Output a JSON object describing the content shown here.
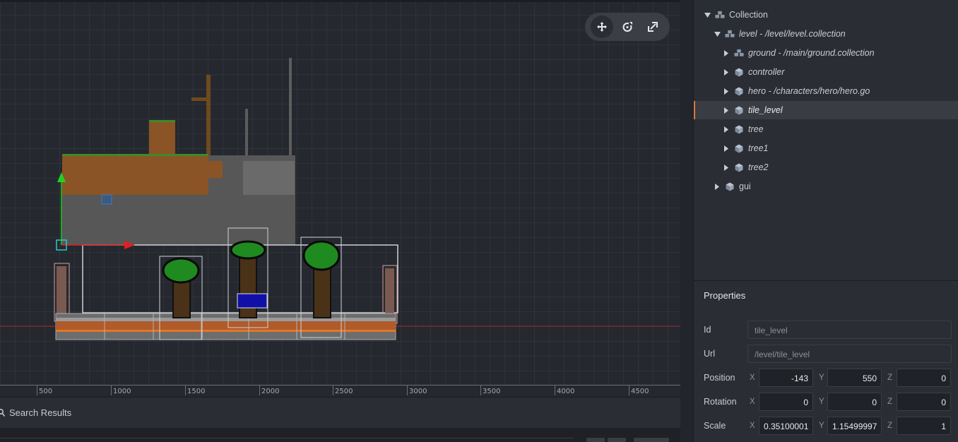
{
  "viewport": {
    "ruler": [
      "500",
      "1000",
      "1500",
      "2000",
      "2500",
      "3000",
      "3500",
      "4000",
      "4500"
    ],
    "toolbar": {
      "move_icon": "move-icon",
      "rotate_icon": "rotate-icon",
      "scale_icon": "scale-icon"
    }
  },
  "bottom": {
    "search_tab": "Search Results"
  },
  "outline": {
    "items": [
      {
        "label": "Collection",
        "icon": "collection-icon",
        "expanded": true
      },
      {
        "label": "level - /level/level.collection",
        "icon": "collection-icon",
        "expanded": true
      },
      {
        "label": "ground - /main/ground.collection",
        "icon": "collection-icon",
        "expanded": false
      },
      {
        "label": "controller",
        "icon": "game-object-icon",
        "expanded": false
      },
      {
        "label": "hero - /characters/hero/hero.go",
        "icon": "game-object-icon",
        "expanded": false
      },
      {
        "label": "tile_level",
        "icon": "game-object-icon",
        "expanded": false,
        "selected": true
      },
      {
        "label": "tree",
        "icon": "game-object-icon",
        "expanded": false
      },
      {
        "label": "tree1",
        "icon": "game-object-icon",
        "expanded": false
      },
      {
        "label": "tree2",
        "icon": "game-object-icon",
        "expanded": false
      },
      {
        "label": "gui",
        "icon": "game-object-icon",
        "expanded": false
      }
    ]
  },
  "properties": {
    "title": "Properties",
    "id_label": "Id",
    "id_value": "tile_level",
    "url_label": "Url",
    "url_value": "/level/tile_level",
    "position_label": "Position",
    "position": {
      "x": "-143",
      "y": "550",
      "z": "0"
    },
    "rotation_label": "Rotation",
    "rotation": {
      "x": "0",
      "y": "0",
      "z": "0"
    },
    "scale_label": "Scale",
    "scale": {
      "x": "0.35100001",
      "y": "1.15499997",
      "z": "1"
    },
    "axis_x": "X",
    "axis_y": "Y",
    "axis_z": "Z"
  },
  "colors": {
    "accent": "#d9773f",
    "gizmo_x": "#e02020",
    "gizmo_y": "#22d022",
    "gizmo_origin": "#28c8c8"
  }
}
